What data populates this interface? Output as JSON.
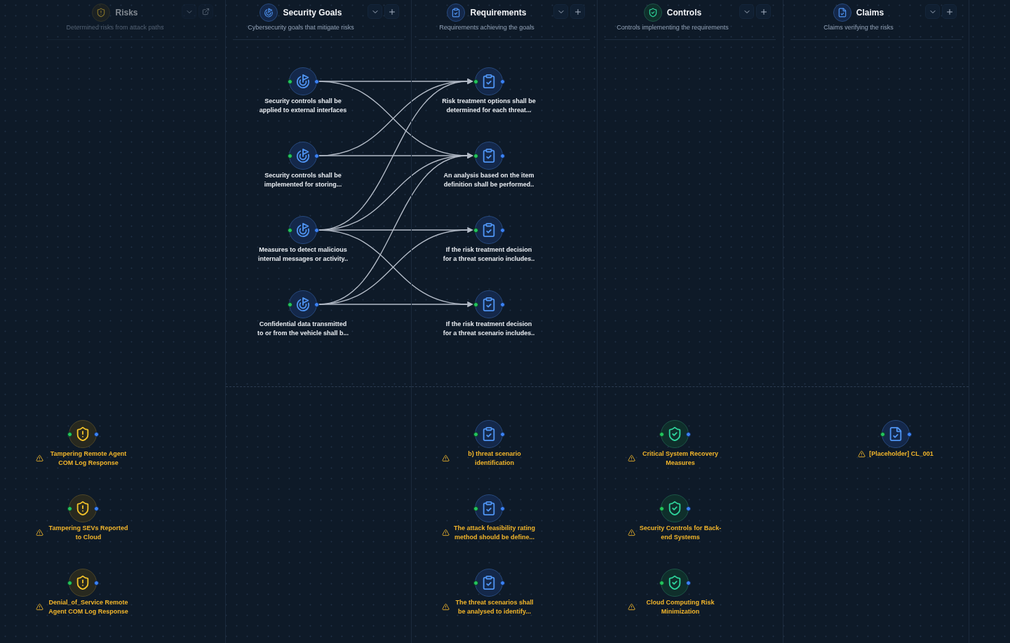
{
  "columns": [
    {
      "kind": "risk",
      "title": "Risks",
      "subtitle": "Determined risks from attack paths",
      "dimmed": true,
      "buttons": [
        {
          "kind": "collapse"
        },
        {
          "kind": "open"
        }
      ],
      "unlinked_nodes": [
        {
          "label": "Tampering Remote Agent COM Log Response",
          "warning": true
        },
        {
          "label": "Tampering SEVs Reported to Cloud",
          "warning": true
        },
        {
          "label": "Denial_of_Service Remote Agent COM Log Response",
          "warning": true
        }
      ]
    },
    {
      "kind": "goal",
      "title": "Security Goals",
      "subtitle": "Cybersecurity goals that mitigate risks",
      "dimmed": false,
      "buttons": [
        {
          "kind": "collapse"
        },
        {
          "kind": "add"
        }
      ],
      "linked_nodes": [
        {
          "label": "Security controls shall be applied to external interfaces",
          "warning": false,
          "links": [
            true,
            true,
            false,
            false
          ]
        },
        {
          "label": "Security controls shall be implemented for storing...",
          "warning": false,
          "links": [
            true,
            true,
            false,
            false
          ]
        },
        {
          "label": "Measures to detect malicious internal messages or activity..",
          "warning": false,
          "links": [
            true,
            true,
            true,
            true
          ]
        },
        {
          "label": "Confidential data transmitted to or from the vehicle shall b...",
          "warning": false,
          "links": [
            false,
            true,
            true,
            true
          ]
        }
      ]
    },
    {
      "kind": "requirement",
      "title": "Requirements",
      "subtitle": "Requirements achieving the goals",
      "dimmed": false,
      "buttons": [
        {
          "kind": "collapse"
        },
        {
          "kind": "add"
        }
      ],
      "linked_nodes": [
        {
          "label": "Risk treatment options shall be determined for each threat...",
          "warning": false
        },
        {
          "label": "An analysis based on the item definition shall be performed..",
          "warning": false
        },
        {
          "label": "If the risk treatment decision for a threat scenario includes..",
          "warning": false
        },
        {
          "label": "If the risk treatment decision for a threat scenario includes..",
          "warning": false
        }
      ],
      "unlinked_nodes": [
        {
          "label": "b) threat scenario identification",
          "warning": true
        },
        {
          "label": "The attack feasibility rating method should be define...",
          "warning": true
        },
        {
          "label": "The threat scenarios shall be analysed to identify...",
          "warning": true
        }
      ]
    },
    {
      "kind": "control",
      "title": "Controls",
      "subtitle": "Controls implementing the requirements",
      "dimmed": false,
      "buttons": [
        {
          "kind": "collapse"
        },
        {
          "kind": "add"
        }
      ],
      "unlinked_nodes": [
        {
          "label": "Critical System Recovery Measures",
          "warning": true
        },
        {
          "label": "Security Controls for Back-end Systems",
          "warning": true
        },
        {
          "label": "Cloud Computing Risk Minimization",
          "warning": true
        }
      ]
    },
    {
      "kind": "claim",
      "title": "Claims",
      "subtitle": "Claims verifying the risks",
      "dimmed": false,
      "buttons": [
        {
          "kind": "collapse"
        },
        {
          "kind": "add"
        }
      ],
      "unlinked_nodes": [
        {
          "label": "[Placeholder] CL_001",
          "warning": true
        }
      ]
    }
  ]
}
